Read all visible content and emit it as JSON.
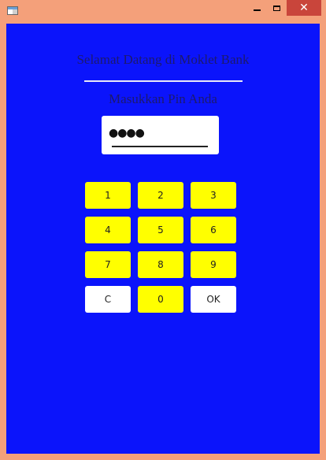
{
  "window": {
    "close_symbol": "✕"
  },
  "screen": {
    "welcome_text": "Selamat Datang di Moklet Bank",
    "prompt_text": "Masukkan Pin Anda",
    "pin_value": "●●●●"
  },
  "keypad": {
    "keys": [
      {
        "label": "1",
        "color": "#ffff00"
      },
      {
        "label": "2",
        "color": "#ffff00"
      },
      {
        "label": "3",
        "color": "#ffff00"
      },
      {
        "label": "4",
        "color": "#ffff00"
      },
      {
        "label": "5",
        "color": "#ffff00"
      },
      {
        "label": "6",
        "color": "#ffff00"
      },
      {
        "label": "7",
        "color": "#ffff00"
      },
      {
        "label": "8",
        "color": "#ffff00"
      },
      {
        "label": "9",
        "color": "#ffff00"
      },
      {
        "label": "C",
        "color": "#ffffff"
      },
      {
        "label": "0",
        "color": "#ffff00"
      },
      {
        "label": "OK",
        "color": "#ffffff"
      }
    ]
  },
  "colors": {
    "background": "#0b14fb",
    "window_border": "#f4a07a",
    "close_button": "#c9453b"
  }
}
